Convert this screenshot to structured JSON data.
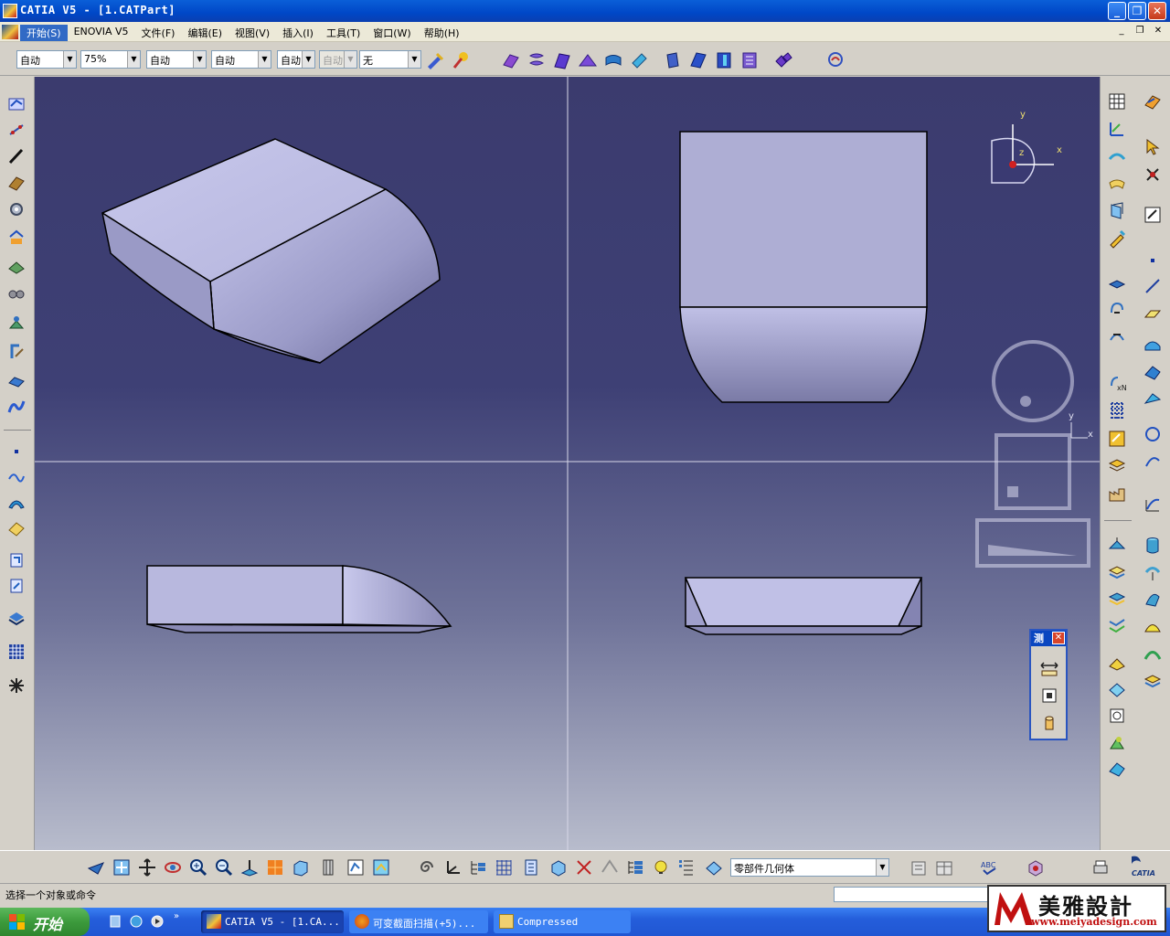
{
  "window": {
    "title": "CATIA V5 - [1.CATPart]",
    "buttons": [
      "_",
      "❐",
      "✕"
    ]
  },
  "menu": {
    "items": [
      "开始(S)",
      "ENOVIA V5",
      "文件(F)",
      "编辑(E)",
      "视图(V)",
      "插入(I)",
      "工具(T)",
      "窗口(W)",
      "帮助(H)"
    ],
    "mdi_buttons": [
      "_",
      "❐",
      "✕"
    ]
  },
  "toolbar": {
    "combos": [
      "自动",
      "75%",
      "自动",
      "自动",
      "自动",
      "自动",
      "无"
    ]
  },
  "viewport": {
    "axis_labels": {
      "x": "x",
      "y": "y",
      "z": "z"
    },
    "corner_axis": {
      "x": "x",
      "y": "y"
    }
  },
  "measure_panel": {
    "title": "测"
  },
  "bottom_toolbar": {
    "body_select": "零部件几何体"
  },
  "status": {
    "prompt": "选择一个对象或命令"
  },
  "taskbar": {
    "start": "开始",
    "tasks": [
      "CATIA V5 - [1.CA...",
      "可变截面扫描(+5)...",
      "Compressed"
    ]
  },
  "watermark": {
    "text": "美雅設計",
    "url": "www.meiyadesign.com"
  },
  "catia_logo": "CATIA",
  "colors": {
    "title_blue": "#0a4fd0",
    "viewport_top": "#3b3b6e",
    "part_face": "#c4c4e8"
  }
}
